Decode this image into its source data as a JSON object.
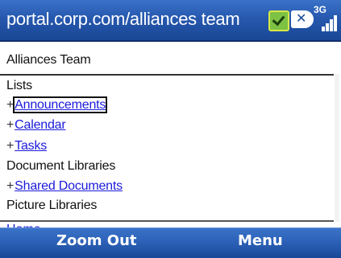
{
  "titlebar": {
    "url": "portal.corp.com/alliances team",
    "network_type": "3G",
    "icons": [
      "security-shield-icon",
      "no-connection-icon",
      "signal-bars-icon"
    ]
  },
  "page": {
    "title": "Alliances Team",
    "sections": [
      {
        "heading": "Lists",
        "links": [
          "Announcements",
          "Calendar",
          "Tasks"
        ]
      },
      {
        "heading": "Document Libraries",
        "links": [
          "Shared Documents"
        ]
      },
      {
        "heading": "Picture Libraries",
        "links": []
      }
    ],
    "focused_link": "Announcements",
    "partially_visible_next": "Home"
  },
  "softkeys": {
    "left": "Zoom Out",
    "right": "Menu"
  },
  "colors": {
    "titlebar": "#2658ae",
    "link": "#1a1adb",
    "shield": "#7dc243"
  }
}
